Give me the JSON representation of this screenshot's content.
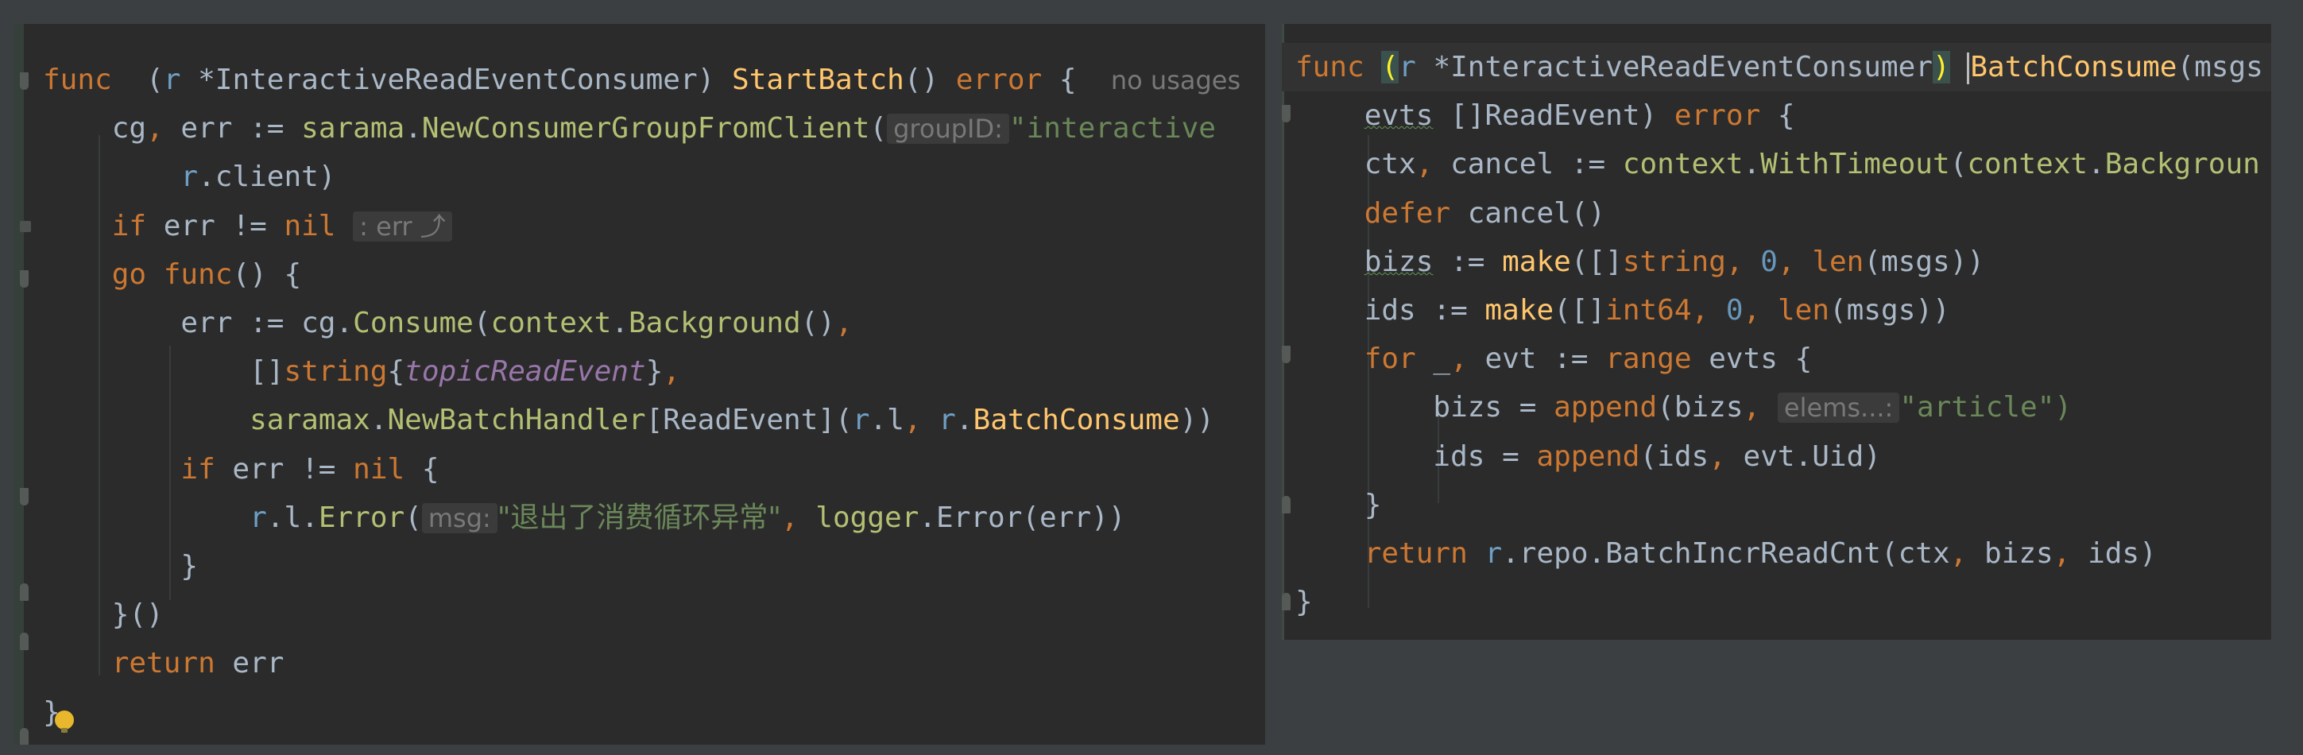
{
  "left": {
    "lines": [
      {
        "id": "l1",
        "tokens": [
          [
            "kw",
            "func"
          ],
          [
            "",
            "  ("
          ],
          [
            "rv",
            "r"
          ],
          [
            "",
            " *"
          ],
          [
            "ty",
            "InteractiveReadEventConsumer"
          ],
          [
            "",
            ") "
          ],
          [
            "fn",
            "StartBatch"
          ],
          [
            "",
            "() "
          ],
          [
            "kw",
            "error"
          ],
          [
            "",
            " {  "
          ]
        ]
      },
      {
        "id": "l2",
        "tokens": [
          [
            "",
            "    "
          ],
          [
            "ty",
            "cg"
          ],
          [
            "kw",
            ","
          ],
          [
            "",
            " err := "
          ],
          [
            "pk",
            "sarama"
          ],
          [
            "",
            "."
          ],
          [
            "pk",
            "NewConsumerGroupFromClient"
          ],
          [
            "",
            "("
          ]
        ]
      },
      {
        "id": "l3",
        "tokens": [
          [
            "",
            "        "
          ],
          [
            "rv",
            "r"
          ],
          [
            "",
            ".client)"
          ]
        ]
      },
      {
        "id": "l4",
        "tokens": [
          [
            "",
            "    "
          ],
          [
            "kw",
            "if"
          ],
          [
            "",
            " err != "
          ],
          [
            "kw",
            "nil"
          ],
          [
            "",
            " "
          ]
        ]
      },
      {
        "id": "l5",
        "tokens": [
          [
            "",
            "    "
          ],
          [
            "kw",
            "go"
          ],
          [
            "",
            " "
          ],
          [
            "kw",
            "func"
          ],
          [
            "",
            "() {"
          ]
        ]
      },
      {
        "id": "l6",
        "tokens": [
          [
            "",
            "        err := cg."
          ],
          [
            "pk",
            "Consume"
          ],
          [
            "",
            "("
          ],
          [
            "pk",
            "context"
          ],
          [
            "",
            "."
          ],
          [
            "pk",
            "Background"
          ],
          [
            "",
            "()"
          ],
          [
            "kw",
            ","
          ]
        ]
      },
      {
        "id": "l7",
        "tokens": [
          [
            "",
            "            []"
          ],
          [
            "kw",
            "string"
          ],
          [
            "",
            "{"
          ],
          [
            "it",
            "topicReadEvent"
          ],
          [
            "",
            "}"
          ],
          [
            "kw",
            ","
          ]
        ]
      },
      {
        "id": "l8",
        "tokens": [
          [
            "",
            "            "
          ],
          [
            "pk",
            "saramax"
          ],
          [
            "",
            "."
          ],
          [
            "pk",
            "NewBatchHandler"
          ],
          [
            "",
            "["
          ],
          [
            "ty",
            "ReadEvent"
          ],
          [
            "",
            "]("
          ],
          [
            "rv",
            "r"
          ],
          [
            "",
            ".l"
          ],
          [
            "kw",
            ","
          ],
          [
            "",
            " "
          ],
          [
            "rv",
            "r"
          ],
          [
            "",
            "."
          ],
          [
            "fn",
            "BatchConsume"
          ],
          [
            "",
            "))"
          ]
        ]
      },
      {
        "id": "l9",
        "tokens": [
          [
            "",
            "        "
          ],
          [
            "kw",
            "if"
          ],
          [
            "",
            " err != "
          ],
          [
            "kw",
            "nil"
          ],
          [
            "",
            " {"
          ]
        ]
      },
      {
        "id": "l10",
        "tokens": [
          [
            "",
            "            "
          ],
          [
            "rv",
            "r"
          ],
          [
            "",
            ".l."
          ],
          [
            "pk",
            "Error"
          ],
          [
            "",
            "("
          ]
        ]
      },
      {
        "id": "l11",
        "tokens": [
          [
            "",
            "        }"
          ]
        ]
      },
      {
        "id": "l12",
        "tokens": [
          [
            "",
            "    }()"
          ]
        ]
      },
      {
        "id": "l13",
        "tokens": [
          [
            "",
            "    "
          ],
          [
            "kw",
            "return"
          ],
          [
            "",
            " err"
          ]
        ]
      },
      {
        "id": "l14",
        "tokens": [
          [
            "",
            "}"
          ]
        ]
      }
    ],
    "usages_hint": "no usages",
    "group_id_hint": "groupID:",
    "group_id_value": "\"interactive",
    "err_fold_hint": ": err",
    "msg_hint": "msg:",
    "msg_value": "\"退出了消费循环异常\"",
    "logger_call": "logger",
    "logger_tail": ".Error(err))"
  },
  "right": {
    "lines": [
      {
        "id": "r1",
        "tokens": [
          [
            "kw",
            "func"
          ],
          [
            "",
            " "
          ]
        ]
      },
      {
        "id": "r2",
        "tokens": [
          [
            "",
            "    "
          ],
          [
            "ul",
            "evts"
          ],
          [
            "",
            " []"
          ],
          [
            "ty",
            "ReadEvent"
          ],
          [
            "",
            ") "
          ],
          [
            "kw",
            "error"
          ],
          [
            "",
            " {"
          ]
        ]
      },
      {
        "id": "r3",
        "tokens": [
          [
            "",
            "    ctx"
          ],
          [
            "kw",
            ","
          ],
          [
            "",
            " cancel := "
          ],
          [
            "pk",
            "context"
          ],
          [
            "",
            "."
          ],
          [
            "pk",
            "WithTimeout"
          ],
          [
            "",
            "("
          ],
          [
            "pk",
            "context"
          ],
          [
            "",
            "."
          ],
          [
            "pk",
            "Backgroun"
          ]
        ]
      },
      {
        "id": "r4",
        "tokens": [
          [
            "",
            "    "
          ],
          [
            "kw",
            "defer"
          ],
          [
            "",
            " cancel()"
          ]
        ]
      },
      {
        "id": "r5",
        "tokens": [
          [
            "",
            "    "
          ],
          [
            "ul",
            "bizs"
          ],
          [
            "",
            " := "
          ],
          [
            "fn",
            "make"
          ],
          [
            "",
            "([]"
          ],
          [
            "kw",
            "string"
          ],
          [
            "kw",
            ","
          ],
          [
            "",
            " "
          ],
          [
            "nm",
            "0"
          ],
          [
            "kw",
            ","
          ],
          [
            "",
            " "
          ],
          [
            "kw",
            "len"
          ],
          [
            "",
            "(msgs))"
          ]
        ]
      },
      {
        "id": "r6",
        "tokens": [
          [
            "",
            "    ids := "
          ],
          [
            "fn",
            "make"
          ],
          [
            "",
            "([]"
          ],
          [
            "kw",
            "int64"
          ],
          [
            "kw",
            ","
          ],
          [
            "",
            " "
          ],
          [
            "nm",
            "0"
          ],
          [
            "kw",
            ","
          ],
          [
            "",
            " "
          ],
          [
            "kw",
            "len"
          ],
          [
            "",
            "(msgs))"
          ]
        ]
      },
      {
        "id": "r7",
        "tokens": [
          [
            "",
            "    "
          ],
          [
            "kw",
            "for"
          ],
          [
            "",
            " _"
          ],
          [
            "kw",
            ","
          ],
          [
            "",
            " evt := "
          ],
          [
            "kw",
            "range"
          ],
          [
            "",
            " evts {"
          ]
        ]
      },
      {
        "id": "r8",
        "tokens": [
          [
            "",
            "        bizs = "
          ],
          [
            "kw",
            "append"
          ],
          [
            "",
            "(bizs"
          ],
          [
            "kw",
            ","
          ],
          [
            "",
            " "
          ]
        ]
      },
      {
        "id": "r9",
        "tokens": [
          [
            "",
            "        ids = "
          ],
          [
            "kw",
            "append"
          ],
          [
            "",
            "(ids"
          ],
          [
            "kw",
            ","
          ],
          [
            "",
            " evt.Uid)"
          ]
        ]
      },
      {
        "id": "r10",
        "tokens": [
          [
            "",
            "    }"
          ]
        ]
      },
      {
        "id": "r11",
        "tokens": [
          [
            "",
            "    "
          ],
          [
            "kw",
            "return"
          ],
          [
            "",
            " "
          ],
          [
            "rv",
            "r"
          ],
          [
            "",
            ".repo.BatchIncrReadCnt(ctx"
          ],
          [
            "kw",
            ","
          ],
          [
            "",
            " bizs"
          ],
          [
            "kw",
            ","
          ],
          [
            "",
            " ids)"
          ]
        ]
      },
      {
        "id": "r12",
        "tokens": [
          [
            "",
            "}"
          ]
        ]
      }
    ],
    "sig_open": "(",
    "sig_recv": "r",
    "sig_type": " *InteractiveReadEventConsumer",
    "sig_close": ")",
    "sig_fn": "BatchConsume",
    "sig_tail": "(msgs",
    "elems_hint": "elems...:",
    "elems_value": "\"article\")"
  },
  "colors": {
    "keyword": "#cc7832",
    "function": "#ffc66d",
    "string": "#6a8759",
    "number": "#6897bb",
    "receiver": "#6e9fc4",
    "package_call": "#b2c073",
    "hint": "#787878",
    "background": "#2b2b2b"
  }
}
